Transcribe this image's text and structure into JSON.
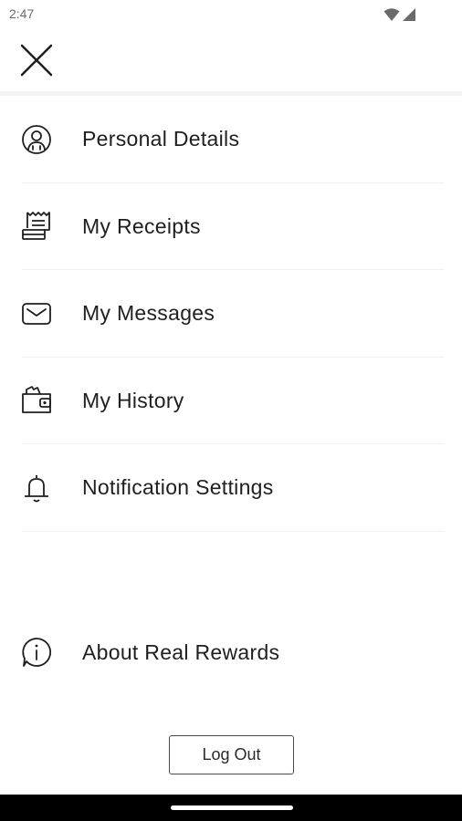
{
  "status_bar": {
    "time": "2:47",
    "icons": [
      "wifi-icon",
      "cell-signal-icon"
    ]
  },
  "header": {
    "close_icon": "close-icon"
  },
  "menu": {
    "items": [
      {
        "label": "Personal Details",
        "icon": "person-icon"
      },
      {
        "label": "My Receipts",
        "icon": "receipt-icon"
      },
      {
        "label": "My Messages",
        "icon": "mail-icon"
      },
      {
        "label": "My History",
        "icon": "wallet-icon"
      },
      {
        "label": "Notification Settings",
        "icon": "bell-icon"
      }
    ]
  },
  "about": {
    "label": "About Real Rewards",
    "icon": "info-icon"
  },
  "logout": {
    "label": "Log Out"
  },
  "colors": {
    "text": "#1f1f1f",
    "divider": "#efefef",
    "nav_bar": "#000000"
  }
}
